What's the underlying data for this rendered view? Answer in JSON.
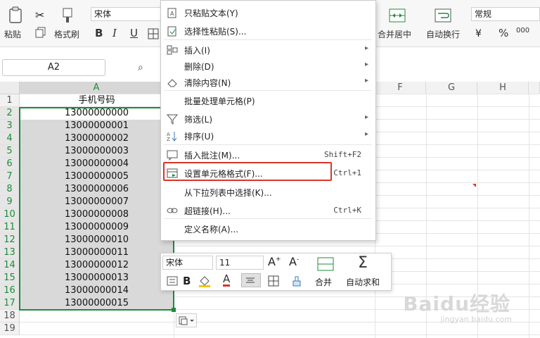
{
  "ribbon": {
    "paste_label": "粘贴",
    "format_painter_label": "格式刷",
    "font_name": "宋体",
    "bold": "B",
    "italic": "I",
    "underline": "U",
    "merge_center_label": "合并居中",
    "wrap_text_label": "自动换行",
    "number_format": "常规",
    "percent": "%",
    "thousands": "000"
  },
  "name_box": {
    "value": "A2"
  },
  "columns": [
    "A",
    "F",
    "G",
    "H"
  ],
  "rows": [
    "1",
    "2",
    "3",
    "4",
    "5",
    "6",
    "7",
    "8",
    "9",
    "10",
    "11",
    "12",
    "13",
    "14",
    "15",
    "16",
    "17",
    "18",
    "19"
  ],
  "cells_a": [
    "手机号码",
    "13000000000",
    "13000000001",
    "13000000002",
    "13000000003",
    "13000000004",
    "13000000005",
    "13000000006",
    "13000000007",
    "13000000008",
    "13000000009",
    "13000000010",
    "13000000011",
    "13000000012",
    "13000000013",
    "13000000014",
    "13000000015"
  ],
  "context_menu": {
    "items": [
      {
        "label": "只粘贴文本(Y)",
        "shortcut": "",
        "submenu": false,
        "icon": "paste-text-icon"
      },
      {
        "label": "选择性粘贴(S)...",
        "shortcut": "",
        "submenu": false,
        "icon": "paste-special-icon"
      },
      {
        "label": "插入(I)",
        "shortcut": "",
        "submenu": true,
        "icon": "insert-icon"
      },
      {
        "label": "删除(D)",
        "shortcut": "",
        "submenu": true,
        "icon": ""
      },
      {
        "label": "清除内容(N)",
        "shortcut": "",
        "submenu": true,
        "icon": "eraser-icon"
      },
      {
        "label": "批量处理单元格(P)",
        "shortcut": "",
        "submenu": false,
        "icon": ""
      },
      {
        "label": "筛选(L)",
        "shortcut": "",
        "submenu": true,
        "icon": "filter-icon"
      },
      {
        "label": "排序(U)",
        "shortcut": "",
        "submenu": true,
        "icon": "sort-icon"
      },
      {
        "label": "插入批注(M)...",
        "shortcut": "Shift+F2",
        "submenu": false,
        "icon": "comment-icon"
      },
      {
        "label": "设置单元格格式(F)...",
        "shortcut": "Ctrl+1",
        "submenu": false,
        "icon": "format-cells-icon"
      },
      {
        "label": "从下拉列表中选择(K)...",
        "shortcut": "",
        "submenu": false,
        "icon": ""
      },
      {
        "label": "超链接(H)...",
        "shortcut": "Ctrl+K",
        "submenu": false,
        "icon": "hyperlink-icon"
      },
      {
        "label": "定义名称(A)...",
        "shortcut": "",
        "submenu": false,
        "icon": ""
      }
    ]
  },
  "mini_toolbar": {
    "font_name": "宋体",
    "font_size": "11",
    "bold": "B",
    "merge_label": "合并",
    "autosum_label": "自动求和"
  },
  "watermark": {
    "brand": "Baidu经验",
    "url": "jingyan.baidu.com"
  },
  "colors": {
    "selection_green": "#1e8c3a",
    "highlight_red": "#d9342b",
    "selection_fill": "#d9d9d9"
  }
}
